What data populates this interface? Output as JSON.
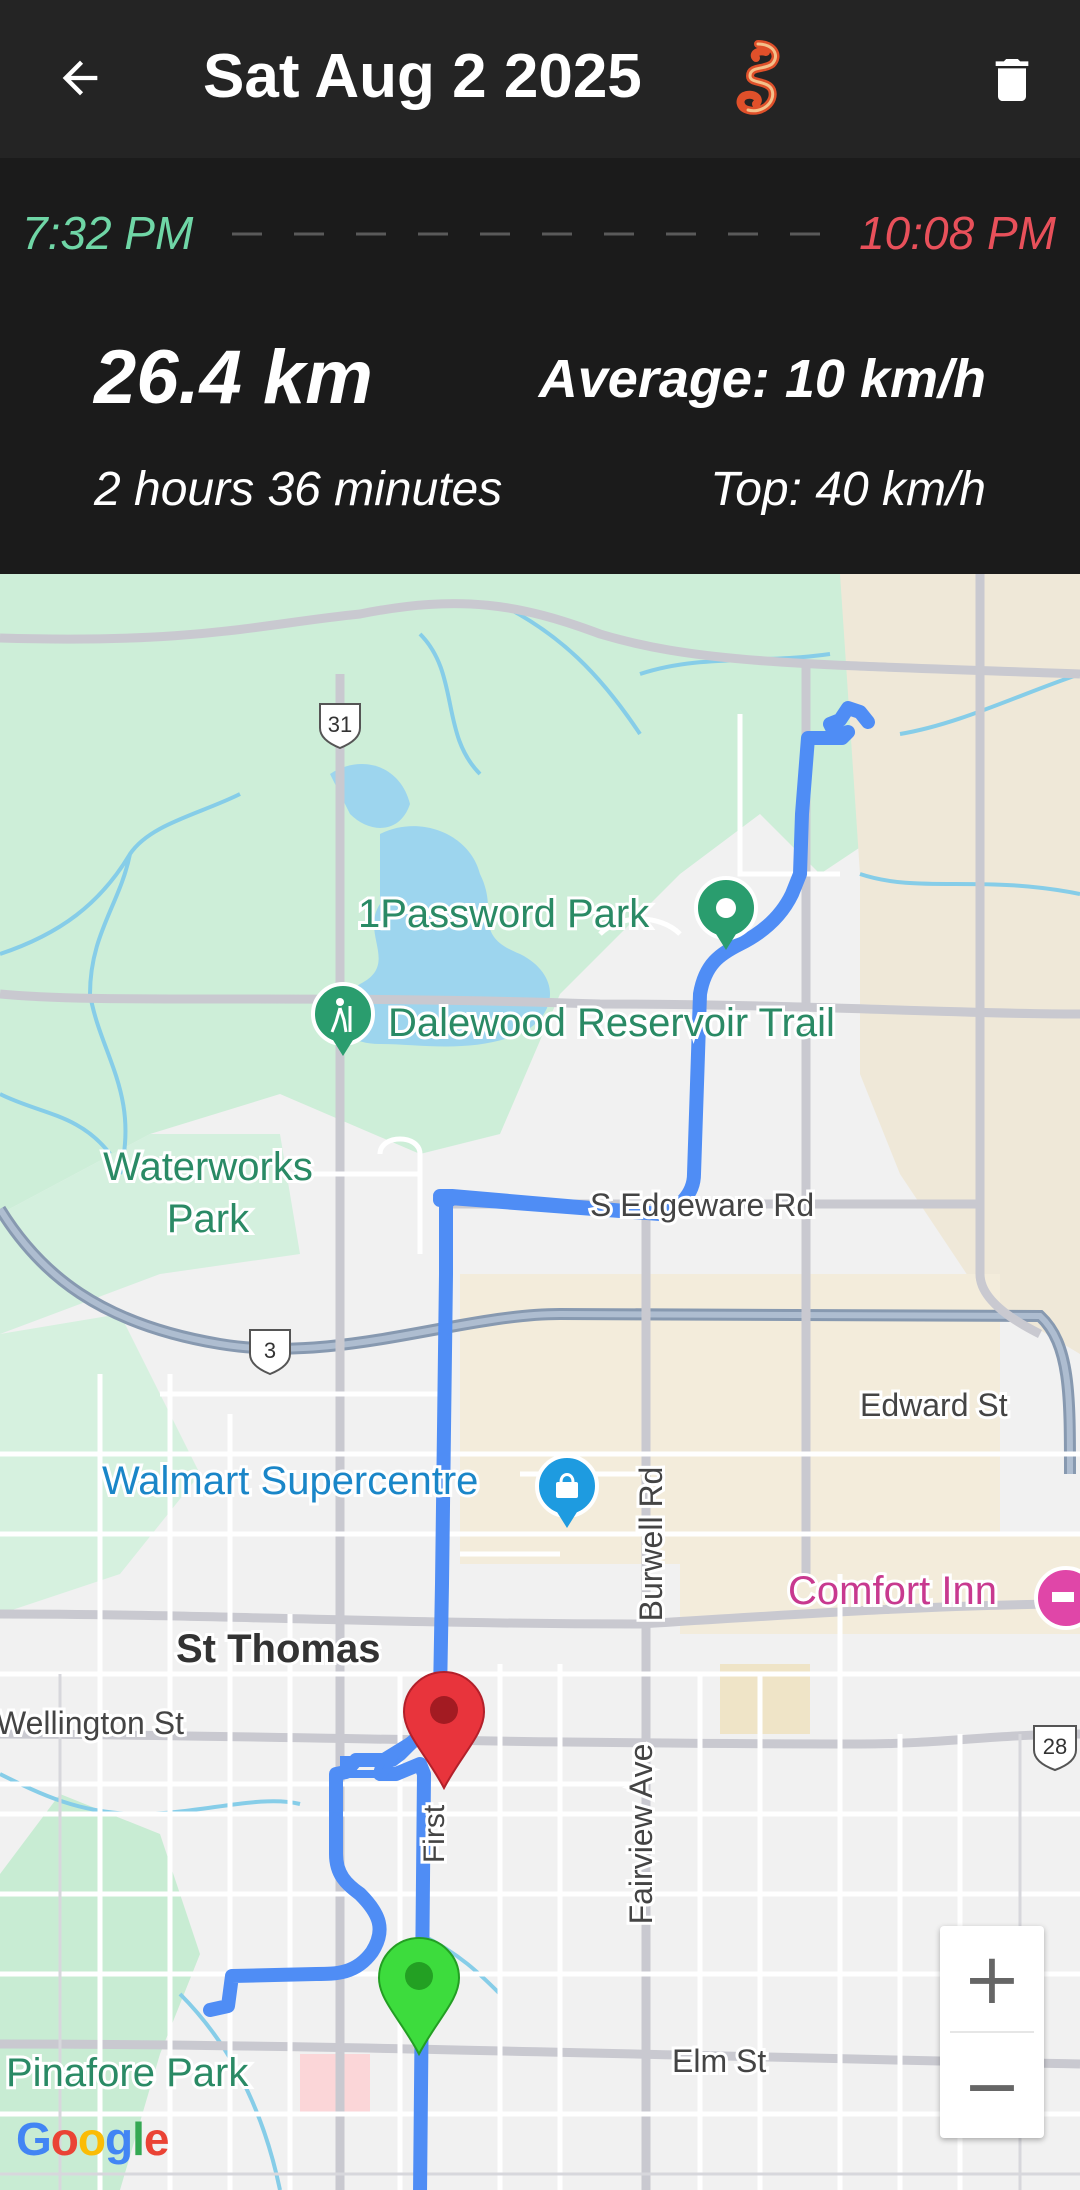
{
  "header": {
    "back_icon": "arrow-left-icon",
    "title": "Sat Aug 2 2025",
    "logo_icon": "rider-logo-icon",
    "delete_icon": "trash-icon"
  },
  "trip": {
    "start_time": "7:32 PM",
    "end_time": "10:08 PM",
    "distance": "26.4 km",
    "average": "Average: 10 km/h",
    "duration": "2 hours 36 minutes",
    "top_speed": "Top: 40 km/h"
  },
  "map": {
    "labels": {
      "park1": "1Password Park",
      "trail": "Dalewood Reservoir Trail",
      "waterworks1": "Waterworks",
      "waterworks2": "Park",
      "edgeware": "S Edgeware Rd",
      "edward": "Edward St",
      "burwell": "Burwell Rd",
      "walmart": "Walmart Supercentre",
      "comfort": "Comfort Inn",
      "stthomas": "St Thomas",
      "wellington": "Wellington St",
      "first": "First",
      "fairview": "Fairview Ave",
      "elm": "Elm St",
      "pinafore": "Pinafore Park"
    },
    "shields": {
      "hwy31": "31",
      "hwy3": "3",
      "hwy28": "28"
    },
    "zoom_in": "+",
    "zoom_out": "−",
    "attribution": "Google",
    "route_color": "#4f8df5",
    "start_marker_color": "#3ddc3d",
    "end_marker_color": "#e8343c"
  }
}
